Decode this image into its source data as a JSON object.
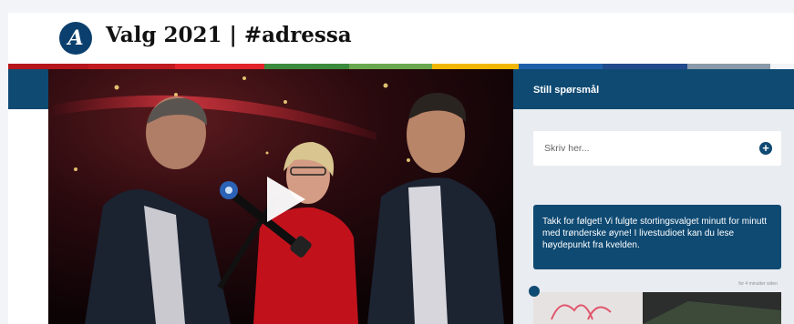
{
  "header": {
    "logo_letter": "A",
    "title": "Valg 2021 | #adressa"
  },
  "party_colors": [
    "#b5161b",
    "#c01b1f",
    "#e1232a",
    "#3c8a3b",
    "#6aa84f",
    "#f2b705",
    "#1f5fa8",
    "#214a8c",
    "#8a9aa8"
  ],
  "video": {
    "play_icon": "play-icon",
    "mic_icon": "microphone-icon"
  },
  "sidebar": {
    "heading": "Still spørsmål",
    "input_placeholder": "Skriv her...",
    "send_icon": "plus-circle-icon",
    "message": "Takk for følget! Vi fulgte stortingsvalget minutt for minutt med trønderske øyne! I livestudioet kan du lese høydepunkt fra kvelden.",
    "timestamp": "for 4 minutter siden"
  },
  "colors": {
    "brand_blue": "#0f4a73",
    "background": "#f2f4f7"
  }
}
